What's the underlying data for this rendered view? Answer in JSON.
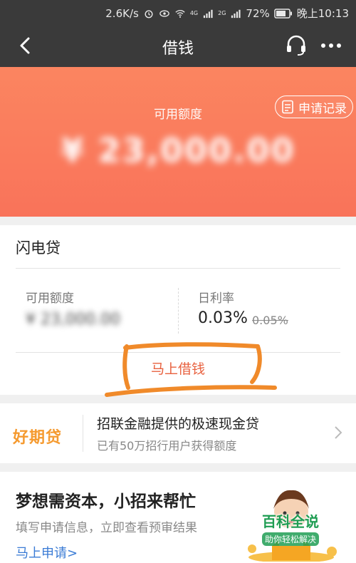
{
  "status_bar": {
    "speed": "2.6K/s",
    "battery": "72%",
    "time": "晚上10:13",
    "net1": "4G",
    "net2": "2G"
  },
  "nav": {
    "title": "借钱"
  },
  "hero": {
    "label": "可用额度",
    "record_button": "申请记录",
    "amount": "¥ 23,000.00"
  },
  "card": {
    "title": "闪电贷",
    "available_label": "可用额度",
    "available_value": "¥ 23,000.00",
    "rate_label": "日利率",
    "rate": "0.03%",
    "rate_old": "0.05%",
    "borrow_button": "马上借钱"
  },
  "promo": {
    "logo": "好期贷",
    "title": "招联金融提供的极速现金贷",
    "subtitle": "已有50万招行用户获得额度"
  },
  "ad": {
    "title": "梦想需资本，小招来帮忙",
    "subtitle": "填写申请信息，立即查看预审结果",
    "link": "马上申请>"
  },
  "watermark": {
    "main": "百科全说",
    "sub": "助你轻松解决"
  },
  "colors": {
    "hero": "#f9735a",
    "accent": "#e8613f",
    "link": "#3a7bd5",
    "promo_logo": "#f59a2f",
    "scribble": "#f08a2a"
  }
}
